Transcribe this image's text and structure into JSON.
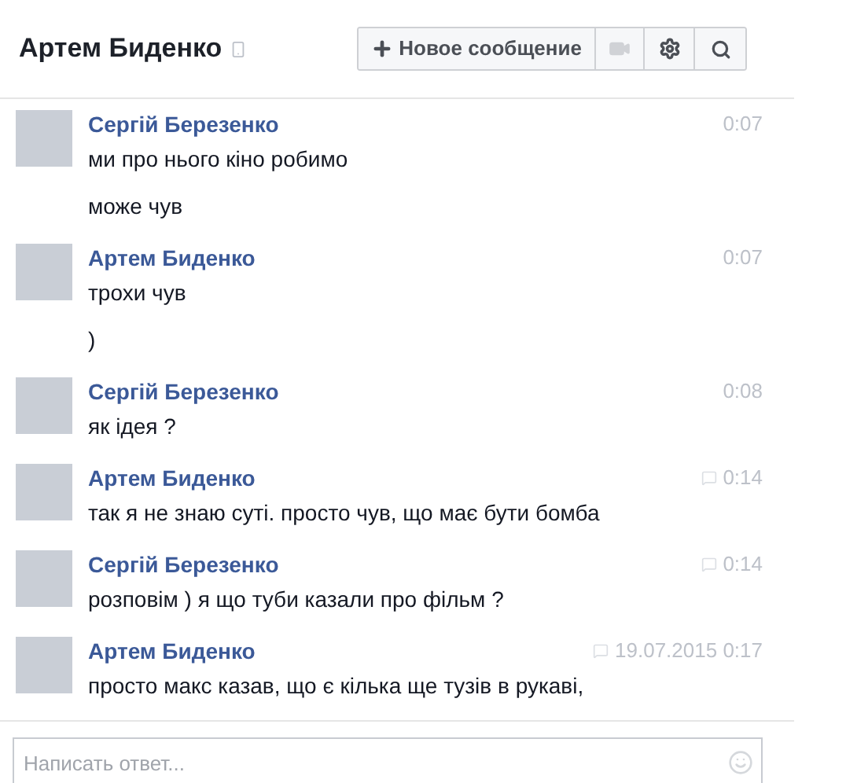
{
  "header": {
    "title": "Артем Биденко",
    "buttons": [
      {
        "kind": "new",
        "label": "Новое сообщение"
      },
      {
        "kind": "video"
      },
      {
        "kind": "settings"
      },
      {
        "kind": "search"
      }
    ]
  },
  "messages": [
    {
      "sender": "Сергій Березенко",
      "time": "0:07",
      "badge": false,
      "lines": [
        "ми про нього кіно робимо",
        "може чув"
      ]
    },
    {
      "sender": "Артем Биденко",
      "time": "0:07",
      "badge": false,
      "lines": [
        "трохи чув",
        ")"
      ]
    },
    {
      "sender": "Сергій Березенко",
      "time": "0:08",
      "badge": false,
      "lines": [
        "як ідея ?"
      ]
    },
    {
      "sender": "Артем Биденко",
      "time": "0:14",
      "badge": true,
      "lines": [
        "так я не знаю суті. просто чув, що має бути бомба"
      ]
    },
    {
      "sender": "Сергій Березенко",
      "time": "0:14",
      "badge": true,
      "lines": [
        "розповім ) я що туби казали про фільм ?"
      ]
    },
    {
      "sender": "Артем Биденко",
      "time": "19.07.2015 0:17",
      "badge": true,
      "lines": [
        "просто макс казав, що є кілька ще тузів в рукаві,"
      ]
    }
  ],
  "composer": {
    "placeholder": "Написать ответ..."
  }
}
